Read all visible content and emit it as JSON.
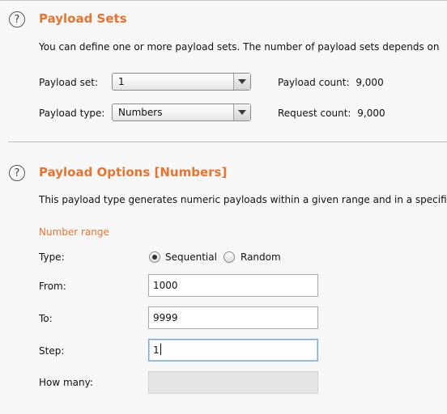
{
  "payload_sets": {
    "title": "Payload Sets",
    "description": "You can define one or more payload sets. The number of payload sets depends on",
    "payload_set_label": "Payload set:",
    "payload_set_value": "1",
    "payload_type_label": "Payload type:",
    "payload_type_value": "Numbers",
    "payload_count_label": "Payload count:",
    "payload_count_value": "9,000",
    "request_count_label": "Request count:",
    "request_count_value": "9,000"
  },
  "payload_options": {
    "title": "Payload Options [Numbers]",
    "description": "This payload type generates numeric payloads within a given range and in a specific",
    "number_range_heading": "Number range",
    "type_label": "Type:",
    "type_options": [
      "Sequential",
      "Random"
    ],
    "type_selected": "Sequential",
    "from_label": "From:",
    "from_value": "1000",
    "to_label": "To:",
    "to_value": "9999",
    "step_label": "Step:",
    "step_value": "1",
    "how_many_label": "How many:",
    "how_many_value": ""
  },
  "icons": {
    "help": "question-circle-icon",
    "dropdown": "chevron-down-icon",
    "radio_selected": "radio-selected-icon",
    "radio_unselected": "radio-unselected-icon"
  },
  "colors": {
    "accent": "#e8732f",
    "background": "#f7f7f7",
    "focus_border": "#7aa7d8"
  }
}
